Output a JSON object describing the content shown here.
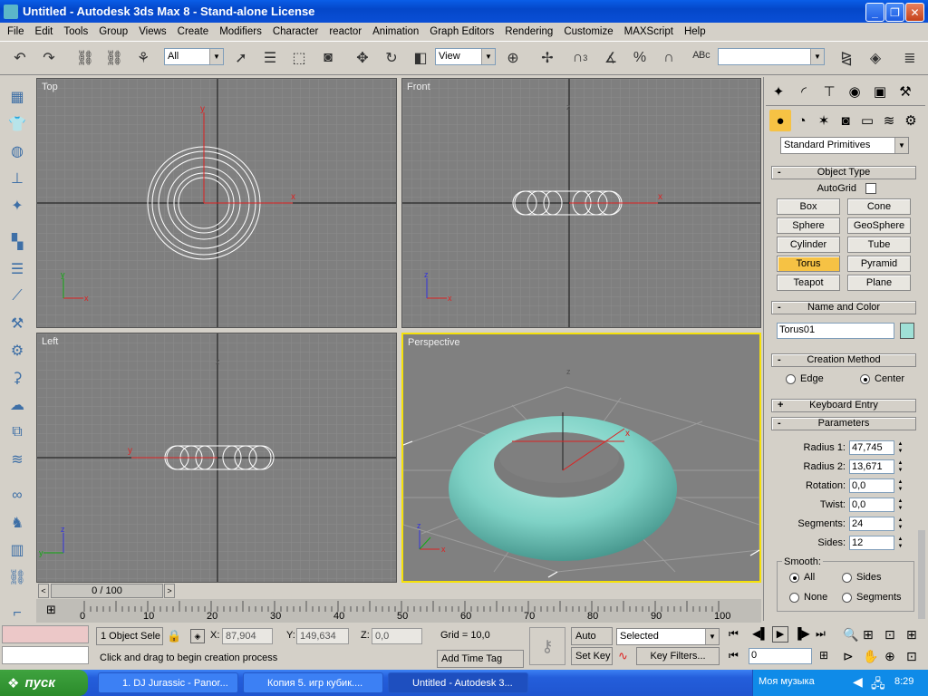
{
  "window": {
    "title": "Untitled - Autodesk 3ds Max 8   - Stand-alone License"
  },
  "menu": [
    "File",
    "Edit",
    "Tools",
    "Group",
    "Views",
    "Create",
    "Modifiers",
    "Character",
    "reactor",
    "Animation",
    "Graph Editors",
    "Rendering",
    "Customize",
    "MAXScript",
    "Help"
  ],
  "toolbar": {
    "selection_filter": "All",
    "ref_coord": "View",
    "snap_label": "3",
    "named_selection": ""
  },
  "viewports": {
    "top": "Top",
    "front": "Front",
    "left": "Left",
    "perspective": "Perspective"
  },
  "axes": {
    "x": "x",
    "y": "y",
    "z": "z"
  },
  "command_panel": {
    "category": "Standard Primitives",
    "object_type_title": "Object Type",
    "autogrid_label": "AutoGrid",
    "buttons": [
      "Box",
      "Cone",
      "Sphere",
      "GeoSphere",
      "Cylinder",
      "Tube",
      "Torus",
      "Pyramid",
      "Teapot",
      "Plane"
    ],
    "selected_button": "Torus",
    "name_color_title": "Name and Color",
    "object_name": "Torus01",
    "object_color": "#9fe0d6",
    "creation_method_title": "Creation Method",
    "creation_edge": "Edge",
    "creation_center": "Center",
    "keyboard_entry_title": "Keyboard Entry",
    "parameters_title": "Parameters",
    "params": [
      {
        "label": "Radius 1:",
        "value": "47,745"
      },
      {
        "label": "Radius 2:",
        "value": "13,671"
      },
      {
        "label": "Rotation:",
        "value": "0,0"
      },
      {
        "label": "Twist:",
        "value": "0,0"
      },
      {
        "label": "Segments:",
        "value": "24"
      },
      {
        "label": "Sides:",
        "value": "12"
      }
    ],
    "smooth_title": "Smooth:",
    "smooth_all": "All",
    "smooth_sides": "Sides",
    "smooth_none": "None",
    "smooth_segments": "Segments"
  },
  "timeline": {
    "frame_display": "0 / 100",
    "ticks": [
      "0",
      "10",
      "20",
      "30",
      "40",
      "50",
      "60",
      "70",
      "80",
      "90",
      "100"
    ]
  },
  "status": {
    "selection": "1 Object Sele",
    "prompt": "Click and drag to begin creation process",
    "x_label": "X:",
    "x_value": "87,904",
    "y_label": "Y:",
    "y_value": "149,634",
    "z_label": "Z:",
    "z_value": "0,0",
    "grid": "Grid = 10,0",
    "add_time_tag": "Add Time Tag",
    "auto_key": "Auto Key",
    "set_key": "Set Key",
    "key_mode": "Selected",
    "key_filters": "Key Filters...",
    "current_frame": "0"
  },
  "taskbar": {
    "start": "пуск",
    "tasks": [
      "1. DJ Jurassic - Panor...",
      "Копия 5. игр кубик....",
      "Untitled - Autodesk 3..."
    ],
    "tray_label": "Моя музыка",
    "clock": "8:29"
  }
}
